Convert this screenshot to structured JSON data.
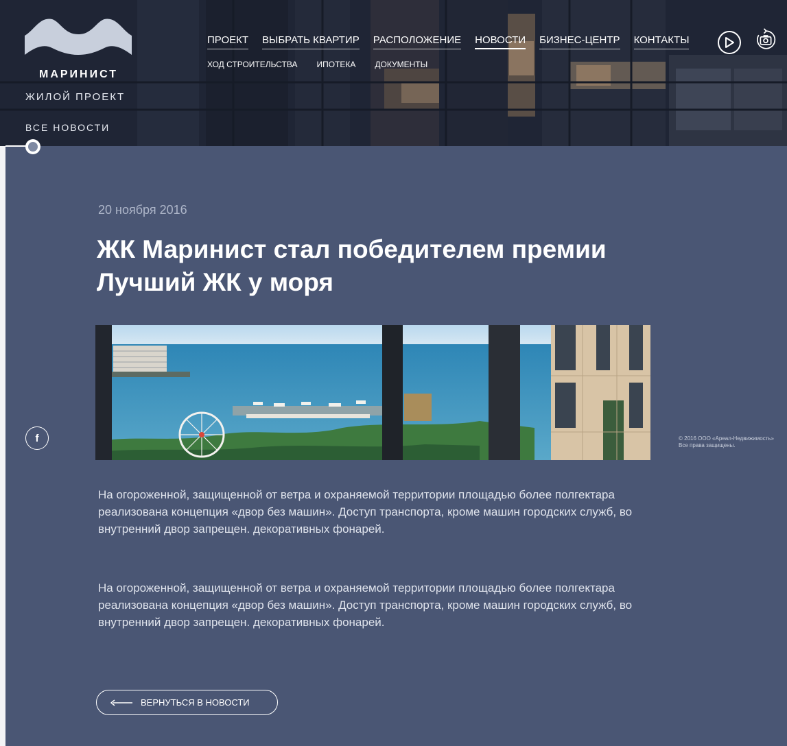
{
  "brand": {
    "name": "МАРИНИСТ",
    "tagline": "ЖИЛОЙ ПРОЕКТ",
    "all_news": "ВСЕ НОВОСТИ"
  },
  "nav": {
    "main": [
      "ПРОЕКТ",
      "ВЫБРАТЬ КВАРТИР",
      "РАСПОЛОЖЕНИЕ",
      "НОВОСТИ",
      "БИЗНЕС-ЦЕНТР",
      "КОНТАКТЫ"
    ],
    "active": "НОВОСТИ",
    "sub": [
      "ХОД СТРОИТЕЛЬСТВА",
      "ИПОТЕКА",
      "ДОКУМЕНТЫ"
    ]
  },
  "header_buttons": {
    "video_icon": "play-icon",
    "photo_icon": "camera-rotate-icon"
  },
  "article": {
    "date": "20 ноября 2016",
    "title": "ЖК Маринист стал победителем премии Лучший ЖК у моря",
    "paragraphs": [
      "На огороженной, защищенной от ветра и охраняемой территории площадью более полгектара реализована концепция «двор без машин». Доступ транспорта, кроме машин городских служб, во внутренний двор запрещен. декоративных фонарей.",
      "На огороженной, защищенной от ветра и охраняемой территории площадью более полгектара реализована концепция «двор без машин». Доступ транспорта, кроме машин городских служб, во внутренний двор запрещен. декоративных фонарей."
    ],
    "back_button": "ВЕРНУТЬСЯ В НОВОСТИ"
  },
  "social": {
    "facebook": "f"
  },
  "footer": {
    "copyright_line1": "© 2016 ООО «Ареал-Недвижимость»",
    "copyright_line2": "Все права защищены."
  },
  "colors": {
    "background": "#4a5674",
    "header_dark": "#1d2230",
    "muted_text": "#aeb6c9"
  }
}
